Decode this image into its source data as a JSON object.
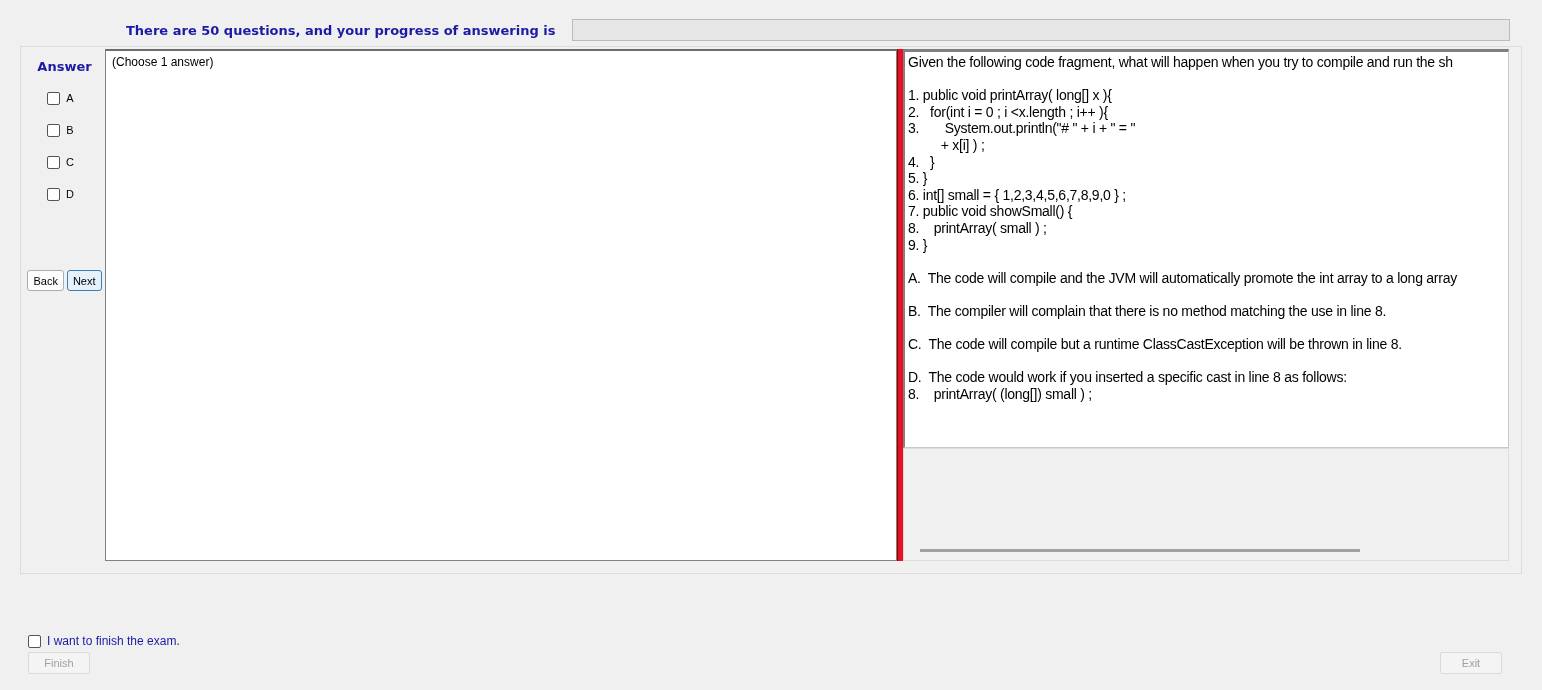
{
  "header": {
    "text": "There are 50 questions, and your progress of answering is",
    "progress": {
      "level": 0
    }
  },
  "answer": {
    "title": "Answer",
    "options": [
      {
        "label": "A",
        "checked": false
      },
      {
        "label": "B",
        "checked": false
      },
      {
        "label": "C",
        "checked": false
      },
      {
        "label": "D",
        "checked": false
      }
    ]
  },
  "nav_buttons": [
    {
      "label": "Back",
      "selected": false
    },
    {
      "label": "Next",
      "selected": true
    }
  ],
  "answer_box": {
    "hint": "(Choose 1 answer)"
  },
  "question": {
    "prompt": "Given the following code fragment, what will happen when you try to compile and run the sh",
    "code": [
      "1. public void printArray( long[] x ){",
      "2.   for(int i = 0 ; i <x.length ; i++ ){",
      "3.       System.out.println(\"# \" + i + \" = \"",
      "         + x[i] ) ;",
      "4.   }",
      "5. }",
      "6. int[] small = { 1,2,3,4,5,6,7,8,9,0 } ;",
      "7. public void showSmall() {",
      "8.    printArray( small ) ;",
      "9. }"
    ],
    "options": [
      {
        "lines": [
          "A.  The code will compile and the JVM will automatically promote the int array to a long array"
        ]
      },
      {
        "lines": [
          "B.  The compiler will complain that there is no method matching the use in line 8."
        ]
      },
      {
        "lines": [
          "C.  The code will compile but a runtime ClassCastException will be thrown in line 8."
        ]
      },
      {
        "lines": [
          "D.  The code would work if you inserted a specific cast in line 8 as follows:",
          "8.    printArray( (long[]) small ) ;"
        ]
      }
    ]
  },
  "finish": {
    "label": "I want to finish the exam.",
    "checked": false,
    "button": {
      "label": "Finish",
      "disabled": true
    }
  },
  "exit_button": {
    "label": "Exit",
    "disabled": true
  }
}
